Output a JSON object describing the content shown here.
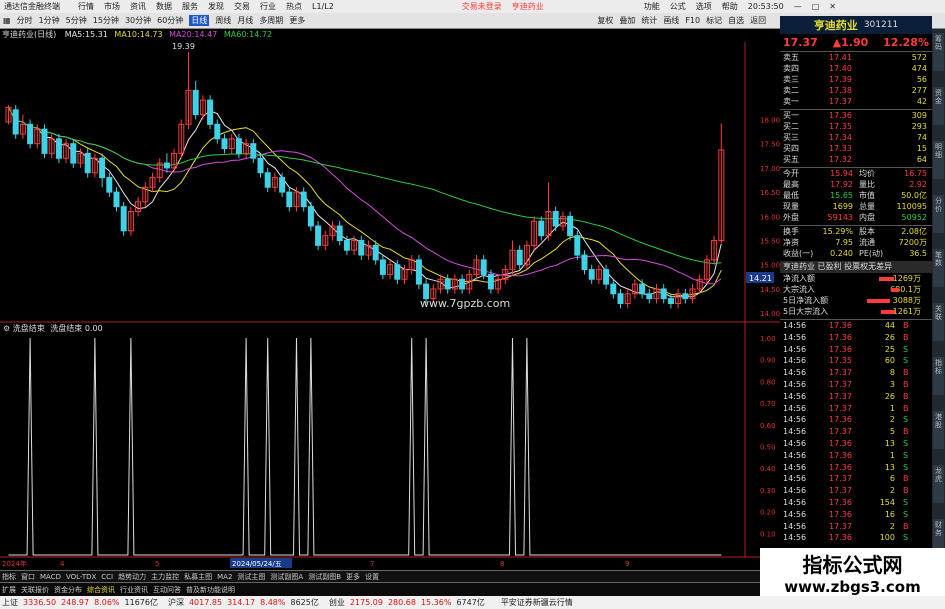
{
  "window": {
    "app_title": "通达信金融终端",
    "menu": [
      "行情",
      "市场",
      "资讯",
      "数据",
      "服务",
      "发现",
      "交易",
      "行业",
      "热点",
      "L1/L2"
    ],
    "center_items": [
      "交易未登录",
      "亨迪药业"
    ],
    "right_menu": [
      "功能",
      "公式",
      "选项",
      "帮助"
    ],
    "clock": "20:53:50"
  },
  "toolbar": {
    "periods": [
      "分时",
      "1分钟",
      "5分钟",
      "15分钟",
      "30分钟",
      "60分钟",
      "日线",
      "周线",
      "月线",
      "多周期",
      "更多"
    ],
    "active_period": "日线",
    "tools": [
      "复权",
      "叠加",
      "统计",
      "画线",
      "F10",
      "标记",
      "自选",
      "返回"
    ]
  },
  "chart_info": {
    "stock": "亨迪药业(日线)",
    "ma": [
      {
        "label": "MA5",
        "value": "15.31",
        "color": "#e6e6e6"
      },
      {
        "label": "MA10",
        "value": "14.73",
        "color": "#e6dc2e"
      },
      {
        "label": "MA20",
        "value": "14.47",
        "color": "#d94be0"
      },
      {
        "label": "MA60",
        "value": "14.72",
        "color": "#2ecc40"
      }
    ],
    "high_label": "19.39",
    "low_label": "14.21",
    "watermark": "www.7gpzb.com"
  },
  "indicator_info": {
    "name": "洗盘结束",
    "line_label": "洗盘结束",
    "value": "0.00"
  },
  "price_axis": [
    "18.00",
    "17.50",
    "17.00",
    "16.50",
    "16.00",
    "15.50",
    "15.00",
    "14.50",
    "14.00"
  ],
  "ind_axis": [
    "1.00",
    "0.90",
    "0.80",
    "0.70",
    "0.60",
    "0.50",
    "0.40",
    "0.30",
    "0.20",
    "0.10",
    "0.00"
  ],
  "date_labels": [
    "2024年",
    "4",
    "5",
    "2024/05/24/五",
    "7",
    "8",
    "9"
  ],
  "stock": {
    "name": "亨迪药业",
    "code": "301211",
    "price": "17.37",
    "change": "▲1.90",
    "pct": "12.28%"
  },
  "sells": [
    {
      "l": "卖五",
      "p": "17.41",
      "v": "572"
    },
    {
      "l": "卖四",
      "p": "17.40",
      "v": "474"
    },
    {
      "l": "卖三",
      "p": "17.39",
      "v": "56"
    },
    {
      "l": "卖二",
      "p": "17.38",
      "v": "277"
    },
    {
      "l": "卖一",
      "p": "17.37",
      "v": "42"
    }
  ],
  "buys": [
    {
      "l": "买一",
      "p": "17.36",
      "v": "309"
    },
    {
      "l": "买二",
      "p": "17.35",
      "v": "293"
    },
    {
      "l": "买三",
      "p": "17.34",
      "v": "74"
    },
    {
      "l": "买四",
      "p": "17.33",
      "v": "15"
    },
    {
      "l": "买五",
      "p": "17.32",
      "v": "64"
    }
  ],
  "stats": [
    [
      "今开",
      "15.94",
      "均价",
      "16.75"
    ],
    [
      "最高",
      "17.92",
      "量比",
      "2.92"
    ],
    [
      "最低",
      "15.65",
      "市值",
      "50.0亿"
    ],
    [
      "现量",
      "1699",
      "总量",
      "110095"
    ],
    [
      "外盘",
      "59143",
      "内盘",
      "50952"
    ],
    [
      "换手",
      "15.29%",
      "股本",
      "2.08亿"
    ],
    [
      "净资",
      "7.95",
      "流通",
      "7200万"
    ],
    [
      "收益(一)",
      "0.240",
      "PE(动)",
      "36.5"
    ]
  ],
  "banner": "亨迪药业 已盈利 投票权无差异",
  "flows": [
    {
      "l": "净流入额",
      "v": "1269万",
      "bar": 60
    },
    {
      "l": "大宗流入",
      "v": "680.1万",
      "bar": 30
    },
    {
      "l": "5日净流入额",
      "v": "3088万",
      "bar": 90
    },
    {
      "l": "5日大宗流入",
      "v": "1261万",
      "bar": 55
    }
  ],
  "ticks": [
    [
      "14:56",
      "17.36",
      "44",
      "B"
    ],
    [
      "14:56",
      "17.36",
      "26",
      "B"
    ],
    [
      "14:56",
      "17.36",
      "25",
      "S"
    ],
    [
      "14:56",
      "17.35",
      "60",
      "S"
    ],
    [
      "14:56",
      "17.37",
      "8",
      "B"
    ],
    [
      "14:56",
      "17.37",
      "3",
      "B"
    ],
    [
      "14:56",
      "17.37",
      "26",
      "B"
    ],
    [
      "14:56",
      "17.37",
      "1",
      "B"
    ],
    [
      "14:56",
      "17.36",
      "2",
      "S"
    ],
    [
      "14:56",
      "17.37",
      "5",
      "B"
    ],
    [
      "14:56",
      "17.36",
      "13",
      "S"
    ],
    [
      "14:56",
      "17.36",
      "1",
      "S"
    ],
    [
      "14:56",
      "17.36",
      "13",
      "S"
    ],
    [
      "14:56",
      "17.37",
      "6",
      "B"
    ],
    [
      "14:56",
      "17.37",
      "2",
      "B"
    ],
    [
      "14:56",
      "17.36",
      "154",
      "S"
    ],
    [
      "14:56",
      "17.36",
      "16",
      "S"
    ],
    [
      "14:56",
      "17.37",
      "2",
      "B"
    ],
    [
      "14:56",
      "17.36",
      "100",
      "S"
    ]
  ],
  "bottom_tabs": [
    "指标",
    "窗口",
    "MACD",
    "VOL-TDX",
    "CCI",
    "趋势动力",
    "主力监控",
    "私募主图",
    "MA2",
    "测试主图",
    "测试副图A",
    "测试副图B",
    "更多",
    "设置"
  ],
  "info_tabs": [
    "扩展",
    "关联报价",
    "资金分布",
    "综合资讯",
    "行业资讯",
    "互动问答",
    "普及新功能说明"
  ],
  "side_tabs": [
    "筹码",
    "资金",
    "明细",
    "分价",
    "笔数",
    "关联",
    "指标",
    "港股",
    "龙虎",
    "财务"
  ],
  "indices": [
    {
      "n": "上证",
      "v": "3336.50",
      "c": "248.97",
      "p": "8.06%",
      "a": "11676亿"
    },
    {
      "n": "沪深",
      "v": "4017.85",
      "c": "314.17",
      "p": "8.48%",
      "a": "8625亿"
    },
    {
      "n": "创业",
      "v": "2175.09",
      "c": "280.68",
      "p": "15.36%",
      "a": "6747亿"
    }
  ],
  "broker": "平安证券新疆云行情",
  "logo": {
    "title": "指标公式网",
    "url": "www.zbgs3.com"
  },
  "chart_data": {
    "type": "candlestick",
    "candles": [
      [
        17.95,
        18.25,
        18.3,
        17.9
      ],
      [
        18.2,
        17.7,
        18.3,
        17.6
      ],
      [
        17.7,
        17.9,
        18.1,
        17.6
      ],
      [
        17.9,
        17.5,
        18.0,
        17.4
      ],
      [
        17.5,
        17.8,
        17.9,
        17.4
      ],
      [
        17.8,
        17.3,
        17.9,
        17.2
      ],
      [
        17.3,
        17.6,
        17.7,
        17.2
      ],
      [
        17.6,
        17.2,
        17.7,
        17.1
      ],
      [
        17.2,
        17.5,
        17.6,
        17.1
      ],
      [
        17.5,
        17.1,
        17.6,
        17.0
      ],
      [
        17.1,
        17.3,
        17.4,
        17.0
      ],
      [
        17.3,
        16.9,
        17.4,
        16.8
      ],
      [
        16.9,
        17.2,
        17.3,
        16.8
      ],
      [
        17.2,
        16.8,
        17.3,
        16.6
      ],
      [
        16.8,
        16.5,
        16.9,
        16.4
      ],
      [
        16.5,
        16.2,
        16.6,
        16.1
      ],
      [
        16.2,
        15.7,
        16.3,
        15.6
      ],
      [
        15.7,
        16.1,
        16.2,
        15.6
      ],
      [
        16.1,
        16.3,
        16.4,
        16.0
      ],
      [
        16.3,
        16.6,
        16.7,
        16.2
      ],
      [
        16.6,
        16.8,
        16.9,
        16.5
      ],
      [
        16.8,
        17.1,
        17.2,
        16.7
      ],
      [
        17.1,
        17.0,
        17.3,
        16.9
      ],
      [
        17.0,
        17.3,
        17.4,
        16.9
      ],
      [
        17.3,
        17.9,
        18.0,
        17.2
      ],
      [
        17.9,
        18.6,
        19.39,
        17.8
      ],
      [
        18.6,
        18.1,
        18.8,
        18.0
      ],
      [
        18.1,
        18.4,
        18.5,
        18.0
      ],
      [
        18.4,
        17.9,
        18.5,
        17.8
      ],
      [
        17.9,
        17.6,
        18.0,
        17.5
      ],
      [
        17.6,
        17.4,
        17.7,
        17.3
      ],
      [
        17.4,
        17.6,
        17.7,
        17.3
      ],
      [
        17.6,
        17.3,
        17.7,
        17.2
      ],
      [
        17.3,
        17.5,
        17.6,
        17.2
      ],
      [
        17.5,
        17.2,
        17.6,
        17.1
      ],
      [
        17.2,
        16.9,
        17.3,
        16.8
      ],
      [
        16.9,
        16.6,
        17.0,
        16.5
      ],
      [
        16.6,
        16.8,
        16.9,
        16.5
      ],
      [
        16.8,
        16.5,
        16.9,
        16.4
      ],
      [
        16.5,
        16.2,
        16.6,
        16.1
      ],
      [
        16.2,
        16.5,
        16.6,
        16.1
      ],
      [
        16.5,
        16.2,
        16.6,
        16.1
      ],
      [
        16.2,
        15.8,
        16.3,
        15.7
      ],
      [
        15.8,
        15.4,
        15.9,
        15.3
      ],
      [
        15.4,
        15.6,
        15.7,
        15.3
      ],
      [
        15.6,
        15.8,
        15.9,
        15.5
      ],
      [
        15.8,
        15.5,
        15.9,
        15.4
      ],
      [
        15.5,
        15.3,
        15.6,
        15.2
      ],
      [
        15.3,
        15.5,
        15.6,
        15.2
      ],
      [
        15.5,
        15.2,
        15.6,
        15.1
      ],
      [
        15.2,
        15.4,
        15.5,
        15.1
      ],
      [
        15.4,
        15.1,
        15.5,
        15.0
      ],
      [
        15.1,
        14.8,
        15.2,
        14.7
      ],
      [
        14.8,
        15.0,
        15.1,
        14.7
      ],
      [
        15.0,
        14.7,
        15.1,
        14.6
      ],
      [
        14.7,
        14.9,
        15.0,
        14.6
      ],
      [
        14.9,
        15.1,
        15.2,
        14.8
      ],
      [
        15.1,
        14.6,
        15.2,
        14.5
      ],
      [
        14.6,
        14.3,
        14.7,
        14.2
      ],
      [
        14.3,
        14.5,
        14.6,
        14.2
      ],
      [
        14.5,
        14.7,
        14.8,
        14.4
      ],
      [
        14.7,
        14.5,
        14.8,
        14.4
      ],
      [
        14.5,
        14.7,
        14.8,
        14.4
      ],
      [
        14.7,
        14.5,
        14.8,
        14.4
      ],
      [
        14.5,
        14.8,
        14.9,
        14.4
      ],
      [
        14.8,
        15.1,
        15.2,
        14.7
      ],
      [
        15.1,
        14.8,
        15.2,
        14.7
      ],
      [
        14.8,
        14.5,
        14.9,
        14.4
      ],
      [
        14.5,
        14.7,
        14.8,
        14.4
      ],
      [
        14.7,
        14.9,
        15.0,
        14.6
      ],
      [
        14.9,
        15.3,
        15.5,
        14.8
      ],
      [
        15.3,
        15.0,
        15.4,
        14.9
      ],
      [
        15.0,
        15.4,
        15.5,
        14.9
      ],
      [
        15.4,
        15.9,
        16.0,
        15.3
      ],
      [
        15.9,
        15.6,
        16.0,
        15.5
      ],
      [
        15.6,
        16.1,
        16.7,
        15.5
      ],
      [
        16.1,
        15.8,
        16.2,
        15.7
      ],
      [
        15.8,
        16.0,
        16.1,
        15.7
      ],
      [
        16.0,
        15.6,
        16.1,
        15.5
      ],
      [
        15.6,
        15.2,
        15.7,
        15.1
      ],
      [
        15.2,
        14.9,
        15.3,
        14.8
      ],
      [
        14.9,
        14.7,
        15.0,
        14.6
      ],
      [
        14.7,
        14.9,
        15.0,
        14.6
      ],
      [
        14.9,
        14.6,
        15.0,
        14.5
      ],
      [
        14.6,
        14.4,
        14.7,
        14.3
      ],
      [
        14.4,
        14.2,
        14.5,
        14.1
      ],
      [
        14.2,
        14.4,
        14.5,
        14.1
      ],
      [
        14.4,
        14.6,
        14.7,
        14.3
      ],
      [
        14.6,
        14.4,
        14.7,
        14.3
      ],
      [
        14.4,
        14.3,
        14.5,
        14.2
      ],
      [
        14.3,
        14.5,
        14.6,
        14.2
      ],
      [
        14.5,
        14.3,
        14.6,
        14.2
      ],
      [
        14.3,
        14.2,
        14.4,
        14.1
      ],
      [
        14.2,
        14.4,
        14.5,
        14.1
      ],
      [
        14.4,
        14.3,
        14.5,
        14.2
      ],
      [
        14.3,
        14.5,
        14.6,
        14.2
      ],
      [
        14.5,
        14.7,
        14.8,
        14.4
      ],
      [
        14.7,
        15.1,
        15.2,
        14.6
      ],
      [
        15.1,
        15.5,
        15.6,
        15.0
      ],
      [
        15.5,
        17.37,
        17.92,
        15.45
      ]
    ],
    "indicator": {
      "name": "洗盘结束",
      "y_range": [
        0,
        1
      ],
      "spikes": [
        3,
        12,
        17,
        33,
        36,
        40,
        42,
        56,
        58,
        70,
        72
      ]
    }
  }
}
